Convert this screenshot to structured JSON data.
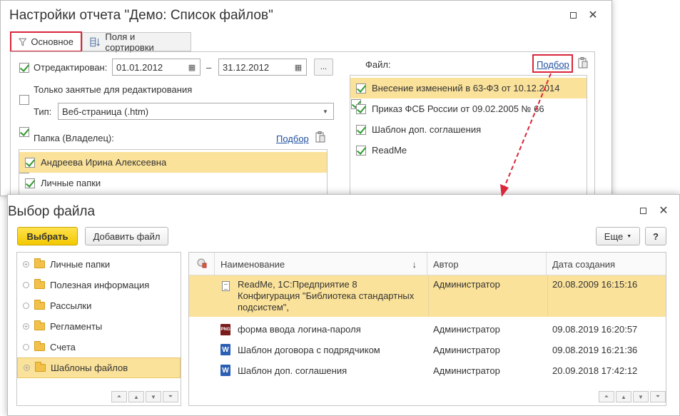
{
  "settings_window": {
    "title": "Настройки отчета \"Демо: Список файлов\"",
    "tabs": [
      {
        "label": "Основное"
      },
      {
        "label": "Поля и сортировки"
      }
    ],
    "edited": {
      "label": "Отредактирован:",
      "from": "01.01.2012",
      "dash": "–",
      "to": "31.12.2012",
      "more_label": "..."
    },
    "only_busy": {
      "label": "Только занятые для редактирования"
    },
    "type": {
      "label": "Тип:",
      "value": "Веб-страница (.htm)"
    },
    "folder": {
      "label": "Папка (Владелец):",
      "pick_label": "Подбор",
      "items": [
        {
          "label": "Андреева Ирина Алексеевна"
        },
        {
          "label": "Личные папки"
        }
      ]
    },
    "file": {
      "label": "Файл:",
      "pick_label": "Подбор",
      "items": [
        {
          "label": "Внесение изменений в 63-ФЗ от  10.12.2014"
        },
        {
          "label": "Приказ ФСБ России от 09.02.2005 № 66"
        },
        {
          "label": "Шаблон доп. соглашения"
        },
        {
          "label": "ReadMe"
        }
      ]
    }
  },
  "select_window": {
    "title": "Выбор файла",
    "toolbar": {
      "select_label": "Выбрать",
      "add_label": "Добавить файл",
      "more_label": "Еще",
      "help_label": "?"
    },
    "tree": [
      {
        "label": "Личные папки"
      },
      {
        "label": "Полезная информация"
      },
      {
        "label": "Рассылки"
      },
      {
        "label": "Регламенты"
      },
      {
        "label": "Счета"
      },
      {
        "label": "Шаблоны файлов"
      }
    ],
    "table": {
      "columns": {
        "name": "Наименование",
        "author": "Автор",
        "date": "Дата создания"
      },
      "rows": [
        {
          "icon": "text-file-icon",
          "name_lines": [
            "ReadMe, 1С:Предприятие 8",
            "Конфигурация \"Библиотека стандартных",
            "подсистем\","
          ],
          "author": "Администратор",
          "date": "20.08.2009 16:15:16"
        },
        {
          "icon": "png-file-icon",
          "name": "форма ввода логина-пароля",
          "author": "Администратор",
          "date": "09.08.2019 16:20:57"
        },
        {
          "icon": "word-file-icon",
          "name": "Шаблон договора с подрядчиком",
          "author": "Администратор",
          "date": "09.08.2019 16:21:36"
        },
        {
          "icon": "word-file-icon",
          "name": "Шаблон доп. соглашения",
          "author": "Администратор",
          "date": "20.09.2018 17:42:12"
        }
      ]
    }
  },
  "colors": {
    "accent_yellow": "#fbe29a",
    "highlight_red": "#d9263a",
    "check_green": "#2f9a2f",
    "link_blue": "#2050a0"
  }
}
